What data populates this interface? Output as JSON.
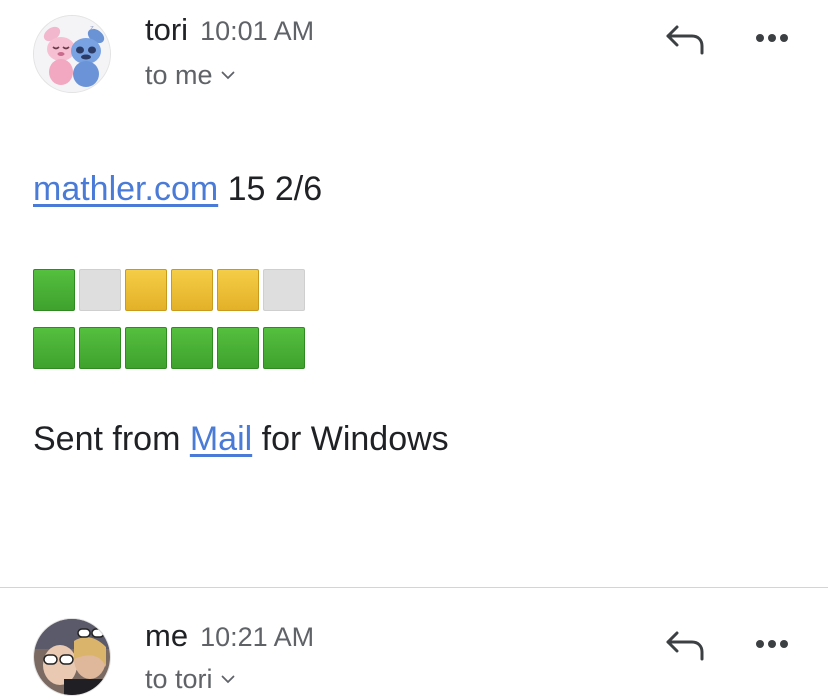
{
  "messages": [
    {
      "sender": "tori",
      "time": "10:01 AM",
      "recipient": "to me",
      "body": {
        "link_text": "mathler.com",
        "result_text": " 15 2/6",
        "grid": [
          [
            "green",
            "gray",
            "yellow",
            "yellow",
            "yellow",
            "gray"
          ],
          [
            "green",
            "green",
            "green",
            "green",
            "green",
            "green"
          ]
        ],
        "signature_prefix": "Sent from ",
        "signature_link": "Mail",
        "signature_suffix": " for Windows"
      }
    },
    {
      "sender": "me",
      "time": "10:21 AM",
      "recipient": "to tori"
    }
  ],
  "icons": {
    "reply": "reply-arrow-icon",
    "more": "more-horizontal-icon",
    "expand": "chevron-down-icon"
  },
  "colors": {
    "link": "#4a7bd6",
    "tile_green": "#4cb23a",
    "tile_yellow": "#ecc039",
    "tile_gray": "#dedede",
    "secondary_text": "#5f6368"
  }
}
